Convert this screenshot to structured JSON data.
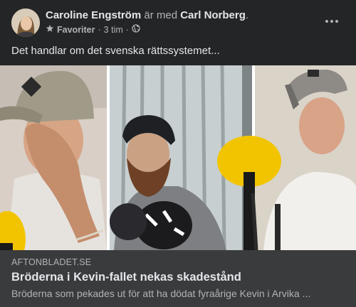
{
  "post": {
    "author": "Caroline Engström",
    "with_text": "är med",
    "tagged": "Carl Norberg",
    "period": ".",
    "audience": "Favoriter",
    "separator": "·",
    "time": "3 tim",
    "separator2": "·",
    "text": "Det handlar om det svenska rättssystemet..."
  },
  "link": {
    "domain": "AFTONBLADET.SE",
    "headline": "Bröderna i Kevin-fallet nekas skadestånd",
    "description": "Bröderna som pekades ut för att ha dödat fyraårige Kevin i Arvika ..."
  },
  "icons": {
    "audience": "star-icon",
    "privacy": "globe-icon",
    "more": "more-horizontal-icon"
  },
  "colors": {
    "background": "#242526",
    "link_box": "#3a3b3c",
    "primary_text": "#e4e6eb",
    "secondary_text": "#b0b3b8",
    "mic_yellow": "#f2c400"
  }
}
